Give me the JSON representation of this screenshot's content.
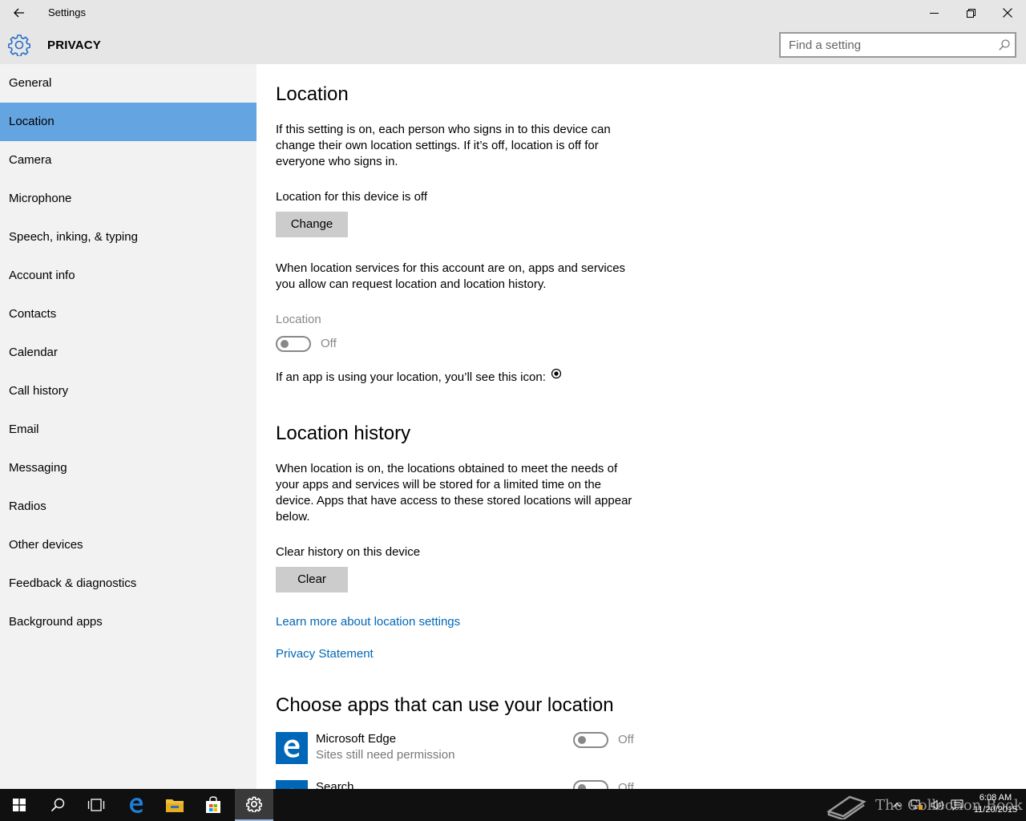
{
  "window": {
    "title": "Settings"
  },
  "header": {
    "title": "PRIVACY",
    "search_placeholder": "Find a setting"
  },
  "sidebar": {
    "items": [
      {
        "label": "General"
      },
      {
        "label": "Location"
      },
      {
        "label": "Camera"
      },
      {
        "label": "Microphone"
      },
      {
        "label": "Speech, inking, & typing"
      },
      {
        "label": "Account info"
      },
      {
        "label": "Contacts"
      },
      {
        "label": "Calendar"
      },
      {
        "label": "Call history"
      },
      {
        "label": "Email"
      },
      {
        "label": "Messaging"
      },
      {
        "label": "Radios"
      },
      {
        "label": "Other devices"
      },
      {
        "label": "Feedback & diagnostics"
      },
      {
        "label": "Background apps"
      }
    ],
    "active": "Location"
  },
  "main": {
    "location_heading": "Location",
    "intro_line1": "If this setting is on, each person who signs in to this device can",
    "intro_line2": "change their own location settings. If it’s off, location is off for",
    "intro_line3": "everyone who signs in.",
    "device_status": "Location for this device is off",
    "change_button": "Change",
    "account_line1": "When location services for this account are on, apps and services",
    "account_line2": "you allow can request location and location history.",
    "location_toggle_label": "Location",
    "location_toggle_state": "Off",
    "icon_note": "If an app is using your location, you’ll see this icon:",
    "history_heading": "Location history",
    "history_line1": "When location is on, the locations obtained to meet the needs of",
    "history_line2": "your apps and services will be stored for a limited time on the",
    "history_line3": "device. Apps that have access to these stored locations will appear",
    "history_line4": "below.",
    "clear_history_label": "Clear history on this device",
    "clear_button": "Clear",
    "learn_more_link": "Learn more about location settings",
    "privacy_link": "Privacy Statement",
    "apps_heading": "Choose apps that can use your location",
    "apps": [
      {
        "name": "Microsoft Edge",
        "subtitle": "Sites still need permission",
        "state": "Off"
      },
      {
        "name": "Search",
        "state": "Off"
      }
    ]
  },
  "taskbar": {
    "watermark": "The Collection Book",
    "time": "6:08 AM",
    "date": "11/20/2015"
  },
  "colors": {
    "accent": "#0067b8",
    "selected_nav": "#64a4e0",
    "titlebar": "#e6e6e6",
    "sidebar": "#f2f2f2",
    "taskbar": "#101010"
  }
}
